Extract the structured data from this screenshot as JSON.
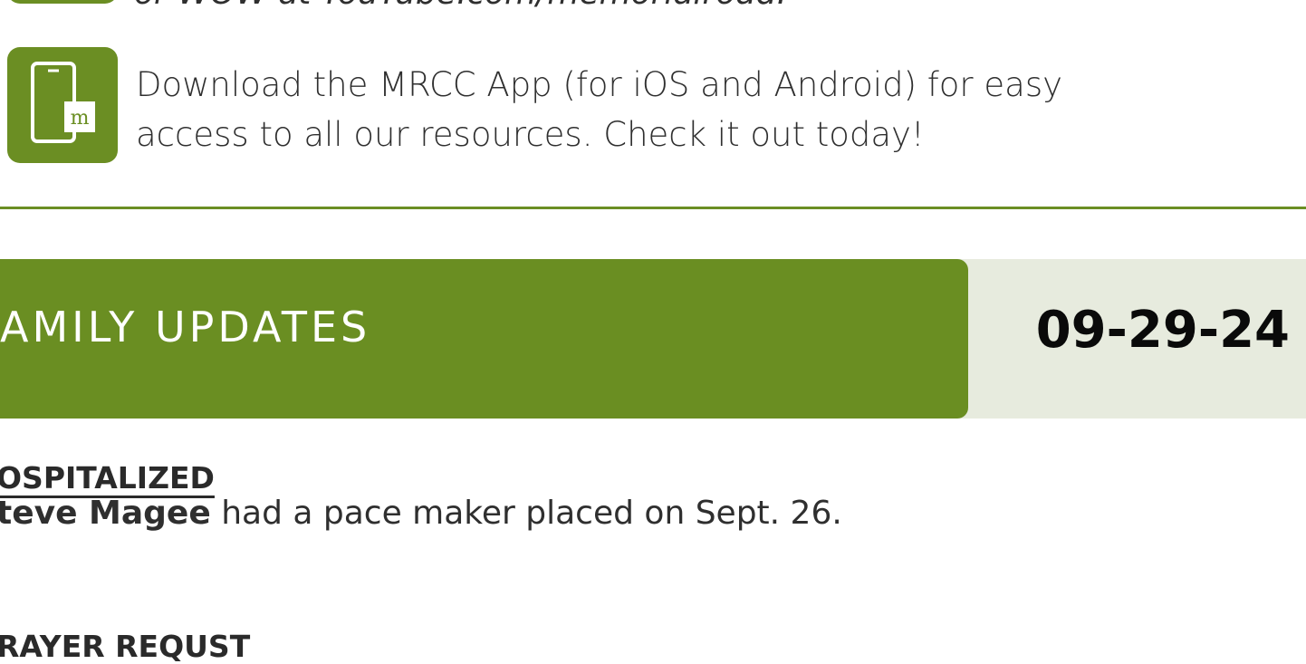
{
  "top_text": "or WOW at YouTube.com/memorialroad.",
  "app_promo": {
    "line1": "Download the MRCC App (for iOS and Android) for easy",
    "line2": "access to all our resources. Check it out today!"
  },
  "banner": {
    "title": "AMILY UPDATES",
    "date": "09-29-24"
  },
  "hospitalized": {
    "heading": "OSPITALIZED",
    "name": "teve Magee",
    "text": " had a pace maker placed on Sept. 26."
  },
  "prayer": {
    "heading": "RAYER REQUST"
  },
  "colors": {
    "accent_green": "#6a8e22",
    "light_panel": "#e7ebde"
  }
}
